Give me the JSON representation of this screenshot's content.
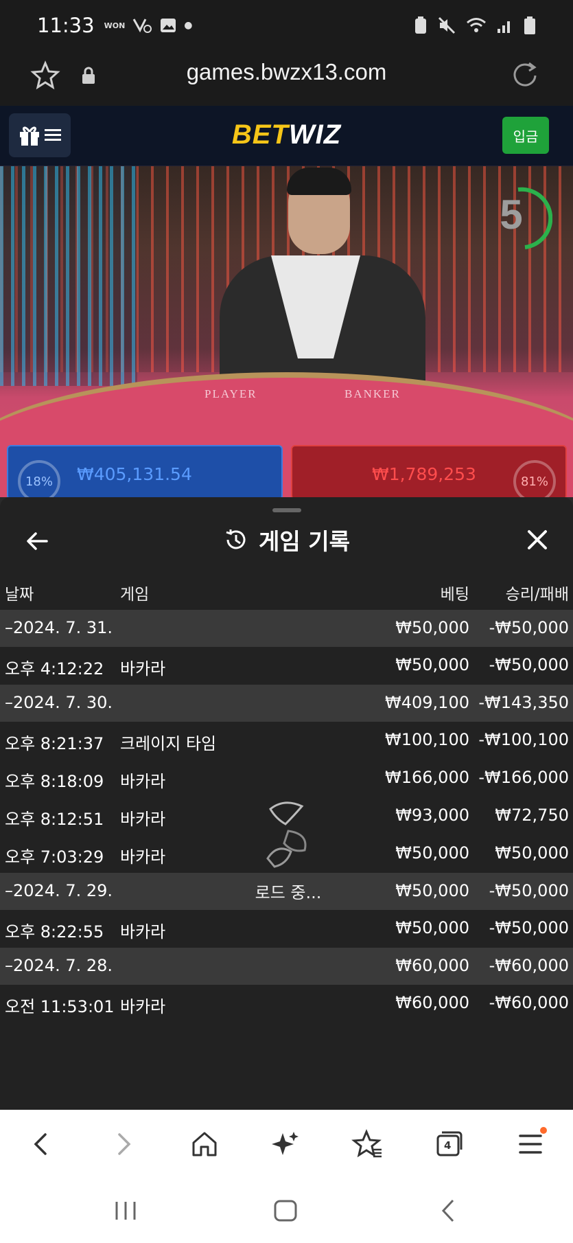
{
  "status_bar": {
    "time": "11:33",
    "notif_won": "WON"
  },
  "browser": {
    "url": "games.bwzx13.com",
    "tab_count": "4"
  },
  "site": {
    "logo_part1": "BET",
    "logo_part2": "WIZ",
    "deposit_label": "입금"
  },
  "game": {
    "countdown": "5",
    "table_player_text": "PLAYER",
    "table_banker_text": "BANKER",
    "player_pct": "18%",
    "player_amount": "₩405,131.54",
    "banker_pct": "81%",
    "banker_amount": "₩1,789,253"
  },
  "history": {
    "title": "게임 기록",
    "columns": {
      "date": "날짜",
      "game": "게임",
      "bet": "베팅",
      "result": "승리/패배"
    },
    "rows": [
      {
        "type": "date",
        "date": "–2024. 7. 31.",
        "game": "",
        "bet": "₩50,000",
        "result": "-₩50,000"
      },
      {
        "type": "item",
        "date": "오후 4:12:22",
        "game": "바카라",
        "bet": "₩50,000",
        "result": "-₩50,000"
      },
      {
        "type": "date",
        "date": "–2024. 7. 30.",
        "game": "",
        "bet": "₩409,100",
        "result": "-₩143,350"
      },
      {
        "type": "item",
        "date": "오후 8:21:37",
        "game": "크레이지 타임",
        "bet": "₩100,100",
        "result": "-₩100,100"
      },
      {
        "type": "item",
        "date": "오후 8:18:09",
        "game": "바카라",
        "bet": "₩166,000",
        "result": "-₩166,000"
      },
      {
        "type": "item",
        "date": "오후 8:12:51",
        "game": "바카라",
        "bet": "₩93,000",
        "result": "₩72,750"
      },
      {
        "type": "item",
        "date": "오후 7:03:29",
        "game": "바카라",
        "bet": "₩50,000",
        "result": "₩50,000"
      },
      {
        "type": "date",
        "date": "–2024. 7. 29.",
        "game": "",
        "bet": "₩50,000",
        "result": "-₩50,000"
      },
      {
        "type": "item",
        "date": "오후 8:22:55",
        "game": "바카라",
        "bet": "₩50,000",
        "result": "-₩50,000"
      },
      {
        "type": "date",
        "date": "–2024. 7. 28.",
        "game": "",
        "bet": "₩60,000",
        "result": "-₩60,000"
      },
      {
        "type": "item",
        "date": "오전 11:53:01",
        "game": "바카라",
        "bet": "₩60,000",
        "result": "-₩60,000"
      }
    ],
    "loading_text": "로드 중..."
  }
}
